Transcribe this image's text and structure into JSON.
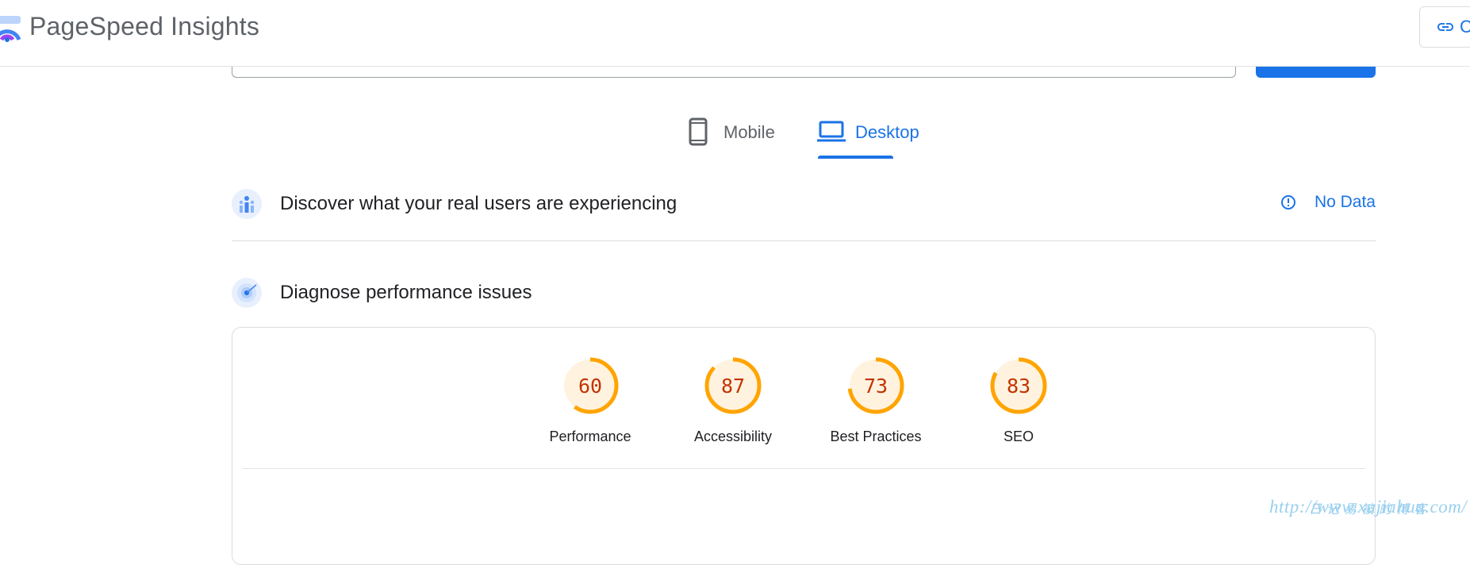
{
  "header": {
    "app_title": "PageSpeed Insights",
    "copy_link_label": "C",
    "logo_icon": "pagespeed-gauge-logo"
  },
  "tabs": [
    {
      "label": "Mobile",
      "icon": "smartphone-icon",
      "active": false
    },
    {
      "label": "Desktop",
      "icon": "laptop-icon",
      "active": true
    }
  ],
  "field_data": {
    "title": "Discover what your real users are experiencing",
    "status": "No Data",
    "icon": "users-chart-icon"
  },
  "lab_data": {
    "title": "Diagnose performance issues",
    "icon": "radar-target-icon"
  },
  "scores": [
    {
      "label": "Performance",
      "value": "60",
      "fraction": 0.6
    },
    {
      "label": "Accessibility",
      "value": "87",
      "fraction": 0.87
    },
    {
      "label": "Best Practices",
      "value": "73",
      "fraction": 0.73
    },
    {
      "label": "SEO",
      "value": "83",
      "fraction": 0.83
    }
  ],
  "colors": {
    "accent": "#1a73e8",
    "score_average": "#ffa400",
    "score_text": "#c33300",
    "score_bg": "#fff3e0"
  },
  "watermark": {
    "url": "http://www.xujiahua.com/",
    "cn": "日记易被的博客"
  }
}
